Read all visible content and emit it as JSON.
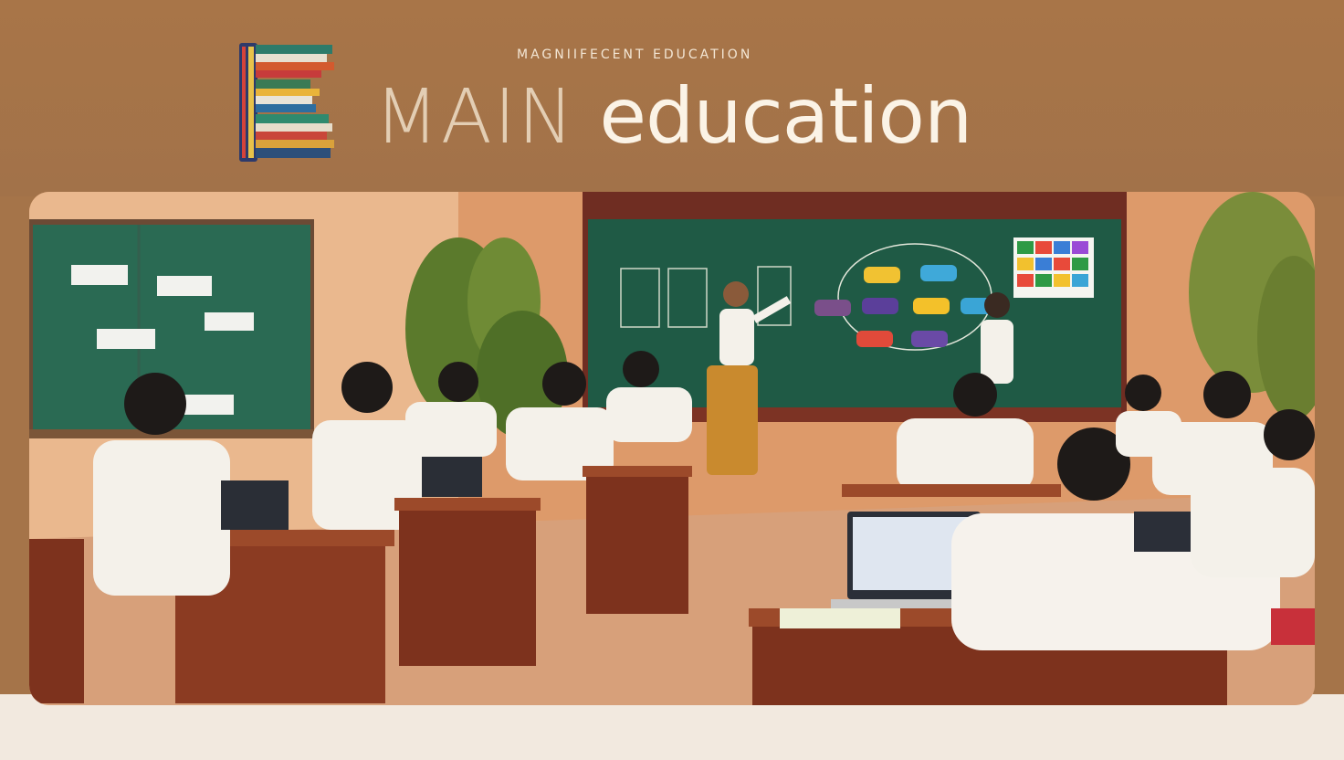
{
  "header": {
    "tagline": "MAGNIIFECENT  EDUCATION",
    "title_part1": "MAIN",
    "title_part2": "education"
  },
  "logo": {
    "icon": "stacked-books-letter-e-icon"
  },
  "scene": {
    "description_icon": "classroom-photo",
    "colors": {
      "background": "#a57449",
      "bottom_band": "#f2e9df",
      "chalkboard": "#1f5a45",
      "wall": "#e8a979"
    }
  }
}
